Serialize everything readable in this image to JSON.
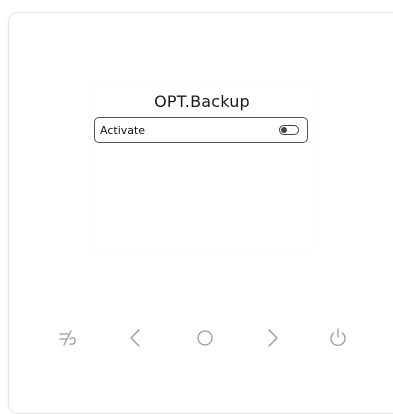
{
  "screen": {
    "title": "OPT.Backup",
    "row": {
      "label": "Activate",
      "toggle_state": "off"
    }
  },
  "buttons": [
    {
      "name": "mode-button",
      "icon": "slash-toggle-icon"
    },
    {
      "name": "left-arrow-button",
      "icon": "chevron-left-icon"
    },
    {
      "name": "ok-button",
      "icon": "circle-icon"
    },
    {
      "name": "right-arrow-button",
      "icon": "chevron-right-icon"
    },
    {
      "name": "power-button",
      "icon": "power-icon"
    }
  ],
  "colors": {
    "icon": "#9a9a9a",
    "frame_border": "#e6e6e6",
    "row_border": "#555555"
  }
}
